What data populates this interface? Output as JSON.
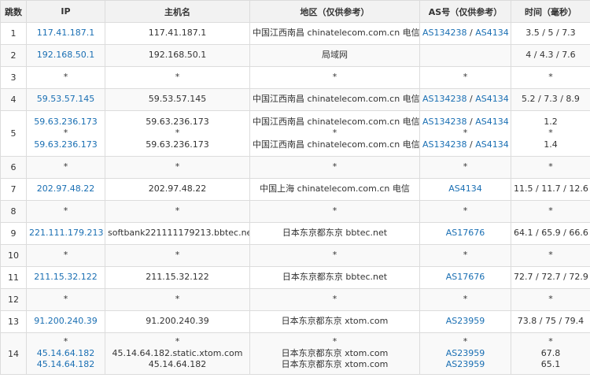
{
  "headers": {
    "hop": "跳数",
    "ip": "IP",
    "host": "主机名",
    "region": "地区（仅供参考）",
    "as": "AS号（仅供参考）",
    "time": "时间（毫秒）"
  },
  "rows": [
    {
      "hop": "1",
      "ip": [
        "117.41.187.1"
      ],
      "host": [
        "117.41.187.1"
      ],
      "region": [
        "中国江西南昌 chinatelecom.com.cn 电信"
      ],
      "as": [
        [
          "AS134238",
          "AS4134"
        ]
      ],
      "time": [
        "3.5 / 5 / 7.3"
      ]
    },
    {
      "hop": "2",
      "ip": [
        "192.168.50.1"
      ],
      "host": [
        "192.168.50.1"
      ],
      "region": [
        "局域网"
      ],
      "as": [
        []
      ],
      "time": [
        "4 / 4.3 / 7.6"
      ]
    },
    {
      "hop": "3",
      "ip": [
        "*"
      ],
      "host": [
        "*"
      ],
      "region": [
        "*"
      ],
      "as": [
        [
          "*"
        ]
      ],
      "time": [
        "*"
      ]
    },
    {
      "hop": "4",
      "ip": [
        "59.53.57.145"
      ],
      "host": [
        "59.53.57.145"
      ],
      "region": [
        "中国江西南昌 chinatelecom.com.cn 电信"
      ],
      "as": [
        [
          "AS134238",
          "AS4134"
        ]
      ],
      "time": [
        "5.2 / 7.3 / 8.9"
      ]
    },
    {
      "hop": "5",
      "ip": [
        "59.63.236.173",
        "*",
        "59.63.236.173"
      ],
      "host": [
        "59.63.236.173",
        "*",
        "59.63.236.173"
      ],
      "region": [
        "中国江西南昌 chinatelecom.com.cn 电信",
        "*",
        "中国江西南昌 chinatelecom.com.cn 电信"
      ],
      "as": [
        [
          "AS134238",
          "AS4134"
        ],
        [
          "*"
        ],
        [
          "AS134238",
          "AS4134"
        ]
      ],
      "time": [
        "1.2",
        "*",
        "1.4"
      ]
    },
    {
      "hop": "6",
      "ip": [
        "*"
      ],
      "host": [
        "*"
      ],
      "region": [
        "*"
      ],
      "as": [
        [
          "*"
        ]
      ],
      "time": [
        "*"
      ]
    },
    {
      "hop": "7",
      "ip": [
        "202.97.48.22"
      ],
      "host": [
        "202.97.48.22"
      ],
      "region": [
        "中国上海 chinatelecom.com.cn 电信"
      ],
      "as": [
        [
          "AS4134"
        ]
      ],
      "time": [
        "11.5 / 11.7 / 12.6"
      ]
    },
    {
      "hop": "8",
      "ip": [
        "*"
      ],
      "host": [
        "*"
      ],
      "region": [
        "*"
      ],
      "as": [
        [
          "*"
        ]
      ],
      "time": [
        "*"
      ]
    },
    {
      "hop": "9",
      "ip": [
        "221.111.179.213"
      ],
      "host": [
        "softbank221111179213.bbtec.net"
      ],
      "region": [
        "日本东京都东京 bbtec.net"
      ],
      "as": [
        [
          "AS17676"
        ]
      ],
      "time": [
        "64.1 / 65.9 / 66.6"
      ]
    },
    {
      "hop": "10",
      "ip": [
        "*"
      ],
      "host": [
        "*"
      ],
      "region": [
        "*"
      ],
      "as": [
        [
          "*"
        ]
      ],
      "time": [
        "*"
      ]
    },
    {
      "hop": "11",
      "ip": [
        "211.15.32.122"
      ],
      "host": [
        "211.15.32.122"
      ],
      "region": [
        "日本东京都东京 bbtec.net"
      ],
      "as": [
        [
          "AS17676"
        ]
      ],
      "time": [
        "72.7 / 72.7 / 72.9"
      ]
    },
    {
      "hop": "12",
      "ip": [
        "*"
      ],
      "host": [
        "*"
      ],
      "region": [
        "*"
      ],
      "as": [
        [
          "*"
        ]
      ],
      "time": [
        "*"
      ]
    },
    {
      "hop": "13",
      "ip": [
        "91.200.240.39"
      ],
      "host": [
        "91.200.240.39"
      ],
      "region": [
        "日本东京都东京 xtom.com"
      ],
      "as": [
        [
          "AS23959"
        ]
      ],
      "time": [
        "73.8 / 75 / 79.4"
      ]
    },
    {
      "hop": "14",
      "ip": [
        "*",
        "45.14.64.182",
        "45.14.64.182"
      ],
      "host": [
        "*",
        "45.14.64.182.static.xtom.com",
        "45.14.64.182"
      ],
      "region": [
        "*",
        "日本东京都东京 xtom.com",
        "日本东京都东京 xtom.com"
      ],
      "as": [
        [
          "*"
        ],
        [
          "AS23959"
        ],
        [
          "AS23959"
        ]
      ],
      "time": [
        "*",
        "67.8",
        "65.1"
      ]
    }
  ],
  "colors": {
    "link": "#1a6fb3",
    "border": "#dcdcdc",
    "header_bg": "#f2f2f2"
  }
}
